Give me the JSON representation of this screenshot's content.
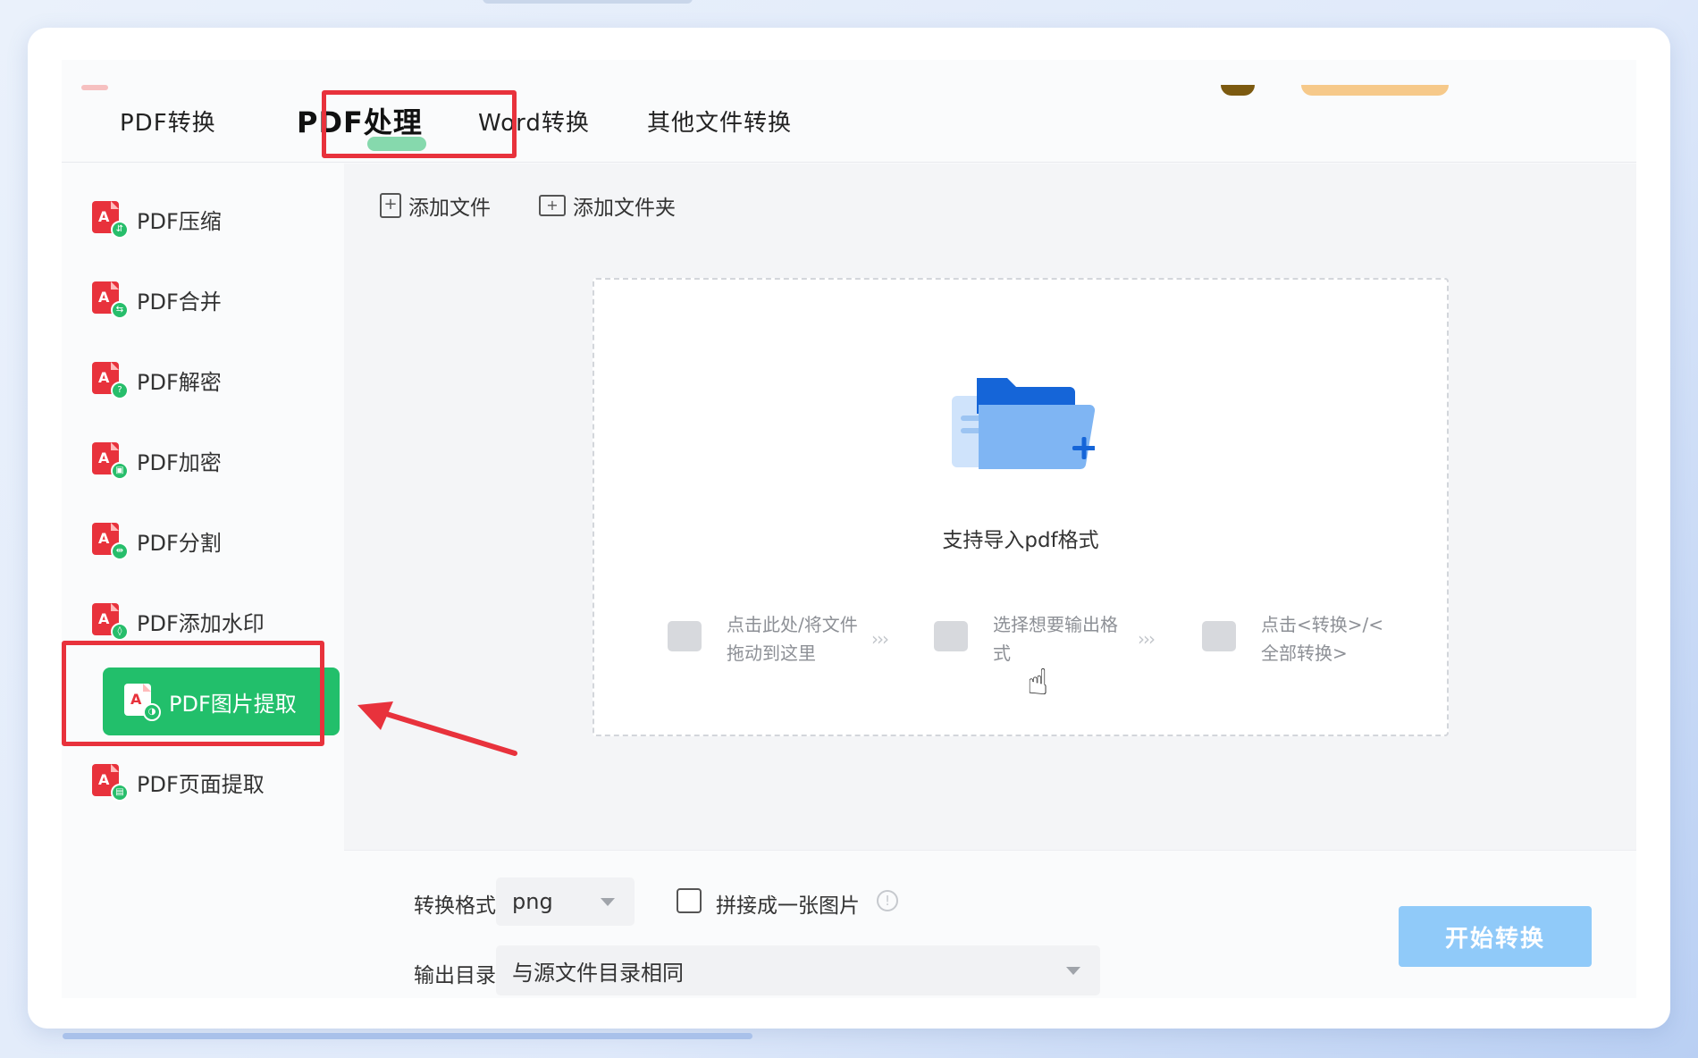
{
  "tabs": [
    {
      "label": "PDF转换",
      "active": false
    },
    {
      "label": "PDF处理",
      "active": true
    },
    {
      "label": "Word转换",
      "active": false
    },
    {
      "label": "其他文件转换",
      "active": false
    }
  ],
  "sidebar": {
    "items": [
      {
        "label": "PDF压缩",
        "icon": "pdf-compress-icon"
      },
      {
        "label": "PDF合并",
        "icon": "pdf-merge-icon"
      },
      {
        "label": "PDF解密",
        "icon": "pdf-decrypt-icon"
      },
      {
        "label": "PDF加密",
        "icon": "pdf-encrypt-icon"
      },
      {
        "label": "PDF分割",
        "icon": "pdf-split-icon"
      },
      {
        "label": "PDF添加水印",
        "icon": "pdf-watermark-icon"
      },
      {
        "label": "PDF图片提取",
        "icon": "pdf-image-extract-icon",
        "active": true
      },
      {
        "label": "PDF页面提取",
        "icon": "pdf-page-extract-icon"
      }
    ]
  },
  "toolbar": {
    "add_file": "添加文件",
    "add_folder": "添加文件夹"
  },
  "dropzone": {
    "title": "支持导入pdf格式",
    "steps": [
      "点击此处/将文件拖动到这里",
      "选择想要输出格式",
      "点击<转换>/<全部转换>"
    ]
  },
  "settings": {
    "format_label": "转换格式",
    "format_value": "png",
    "merge_label": "拼接成一张图片",
    "merge_checked": false,
    "output_label": "输出目录",
    "output_value": "与源文件目录相同",
    "start_button": "开始转换"
  },
  "colors": {
    "accent_green": "#22bf6b",
    "highlight_red": "#e8323c",
    "start_button": "#90caf9"
  }
}
